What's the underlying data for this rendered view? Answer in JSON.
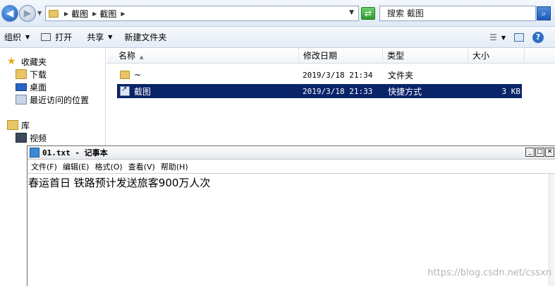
{
  "explorer": {
    "breadcrumb": [
      "截图",
      "截图"
    ],
    "search_placeholder": "搜索 截图",
    "toolbar": {
      "organize": "组织",
      "open": "打开",
      "share": "共享",
      "new_folder": "新建文件夹"
    },
    "nav": {
      "favorites": "收藏夹",
      "downloads": "下载",
      "desktop": "桌面",
      "recent_places": "最近访问的位置",
      "libraries": "库",
      "videos": "视频"
    },
    "columns": {
      "name": "名称",
      "date": "修改日期",
      "type": "类型",
      "size": "大小"
    },
    "files": [
      {
        "name": "~",
        "date": "2019/3/18 21:34",
        "type": "文件夹",
        "size": "",
        "selected": false
      },
      {
        "name": "截图",
        "date": "2019/3/18 21:33",
        "type": "快捷方式",
        "size": "3 KB",
        "selected": true
      }
    ]
  },
  "notepad": {
    "title": "01.txt - 记事本",
    "menu": [
      "文件(F)",
      "编辑(E)",
      "格式(O)",
      "查看(V)",
      "帮助(H)"
    ],
    "content": "春运首日 铁路预计发送旅客900万人次"
  },
  "watermark": "https://blog.csdn.net/cssxn"
}
